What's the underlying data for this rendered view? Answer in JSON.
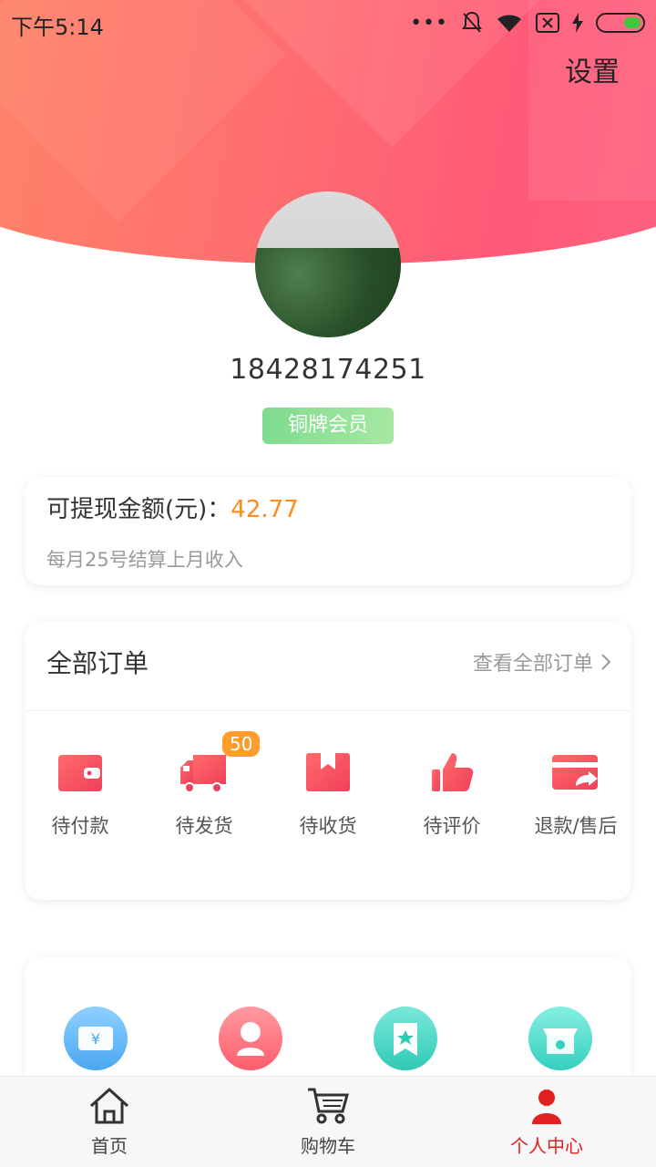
{
  "status_bar": {
    "time": "下午5:14",
    "dots": "•••"
  },
  "header": {
    "settings_label": "设置"
  },
  "profile": {
    "phone": "18428174251",
    "member_level": "铜牌会员"
  },
  "balance": {
    "label": "可提现金额(元)：",
    "amount": "42.77",
    "note": "每月25号结算上月收入"
  },
  "orders": {
    "title": "全部订单",
    "view_all": "查看全部订单",
    "items": [
      {
        "label": "待付款",
        "icon": "wallet-icon"
      },
      {
        "label": "待发货",
        "icon": "truck-icon",
        "badge": "50"
      },
      {
        "label": "待收货",
        "icon": "box-icon"
      },
      {
        "label": "待评价",
        "icon": "thumbs-up-icon"
      },
      {
        "label": "退款/售后",
        "icon": "card-return-icon"
      }
    ]
  },
  "services": [
    {
      "icon": "coupon-icon",
      "color": "#5bb3f5"
    },
    {
      "icon": "person-icon",
      "color": "#ff6f7a"
    },
    {
      "icon": "bookmark-star-icon",
      "color": "#3fd2c1"
    },
    {
      "icon": "shop-icon",
      "color": "#43d6c6"
    }
  ],
  "bottom_nav": [
    {
      "label": "首页",
      "icon": "home-icon"
    },
    {
      "label": "购物车",
      "icon": "cart-icon"
    },
    {
      "label": "个人中心",
      "icon": "user-center-icon",
      "active": true
    }
  ],
  "colors": {
    "accent": "#ff5a78",
    "active_nav": "#e32020",
    "amount": "#ff8a1e",
    "badge": "#ff9c2a"
  }
}
